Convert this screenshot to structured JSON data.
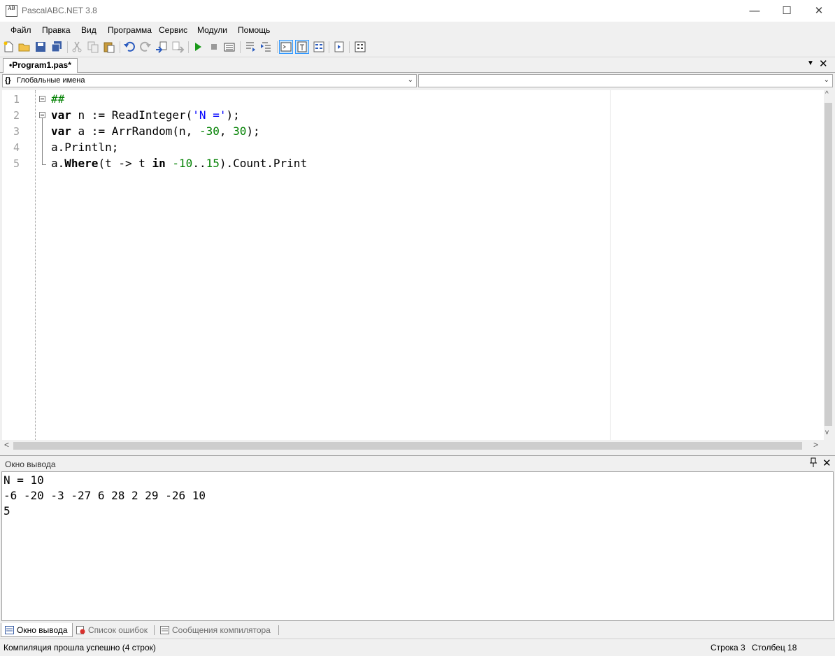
{
  "window": {
    "title": "PascalABC.NET 3.8",
    "icon_text": "AB",
    "min_glyph": "—",
    "max_glyph": "☐",
    "close_glyph": "✕"
  },
  "menu": [
    "Файл",
    "Правка",
    "Вид",
    "Программа",
    "Сервис",
    "Модули",
    "Помощь"
  ],
  "toolbar": {
    "icons": [
      "new-file-icon",
      "open-icon",
      "save-icon",
      "save-all-icon",
      "cut-icon",
      "copy-icon",
      "paste-icon",
      "undo-icon",
      "redo-icon",
      "find-icon",
      "replace-icon",
      "run-icon",
      "stop-icon",
      "compile-icon",
      "step-into-icon",
      "step-over-icon",
      "console-icon",
      "text-icon",
      "format-icon",
      "debug-icon",
      "code-icon"
    ]
  },
  "tabs": {
    "active": "•Program1.pas*",
    "dropdown_glyph": "▼",
    "close_glyph": "✕"
  },
  "combos": {
    "left": "Глобальные имена",
    "left_icon": "{}",
    "right": "",
    "arrow": "⌄"
  },
  "editor": {
    "line_numbers": [
      "1",
      "2",
      "3",
      "4",
      "5"
    ],
    "lines": [
      [
        {
          "t": "##",
          "c": "com"
        }
      ],
      [
        {
          "t": "var",
          "c": "kw"
        },
        {
          "t": " n := ReadInteger(",
          "c": ""
        },
        {
          "t": "'N ='",
          "c": "str"
        },
        {
          "t": ");",
          "c": ""
        }
      ],
      [
        {
          "t": "var",
          "c": "kw"
        },
        {
          "t": " a := ArrRandom(n, ",
          "c": ""
        },
        {
          "t": "-30",
          "c": "num"
        },
        {
          "t": ", ",
          "c": ""
        },
        {
          "t": "30",
          "c": "num"
        },
        {
          "t": ");",
          "c": ""
        }
      ],
      [
        {
          "t": "a.Println;",
          "c": ""
        }
      ],
      [
        {
          "t": "a.",
          "c": ""
        },
        {
          "t": "Where",
          "c": "kw"
        },
        {
          "t": "(t -> t ",
          "c": ""
        },
        {
          "t": "in",
          "c": "kw"
        },
        {
          "t": " ",
          "c": ""
        },
        {
          "t": "-10",
          "c": "num"
        },
        {
          "t": "..",
          "c": ""
        },
        {
          "t": "15",
          "c": "num"
        },
        {
          "t": ").Count.Print",
          "c": ""
        }
      ]
    ],
    "scroll_left": "<",
    "scroll_right": ">",
    "scroll_up": "^",
    "scroll_down": "v"
  },
  "output": {
    "title": "Окно вывода",
    "pin_glyph": "📌",
    "close_glyph": "✕",
    "lines": [
      "N = 10",
      "-6 -20 -3 -27 6 28 2 29 -26 10",
      "5"
    ]
  },
  "bottom_tabs": [
    "Окно вывода",
    "Список ошибок",
    "Сообщения компилятора"
  ],
  "status": {
    "message": "Компиляция прошла успешно (4 строк)",
    "row_label": "Строка  3",
    "col_label": "Столбец  18"
  }
}
